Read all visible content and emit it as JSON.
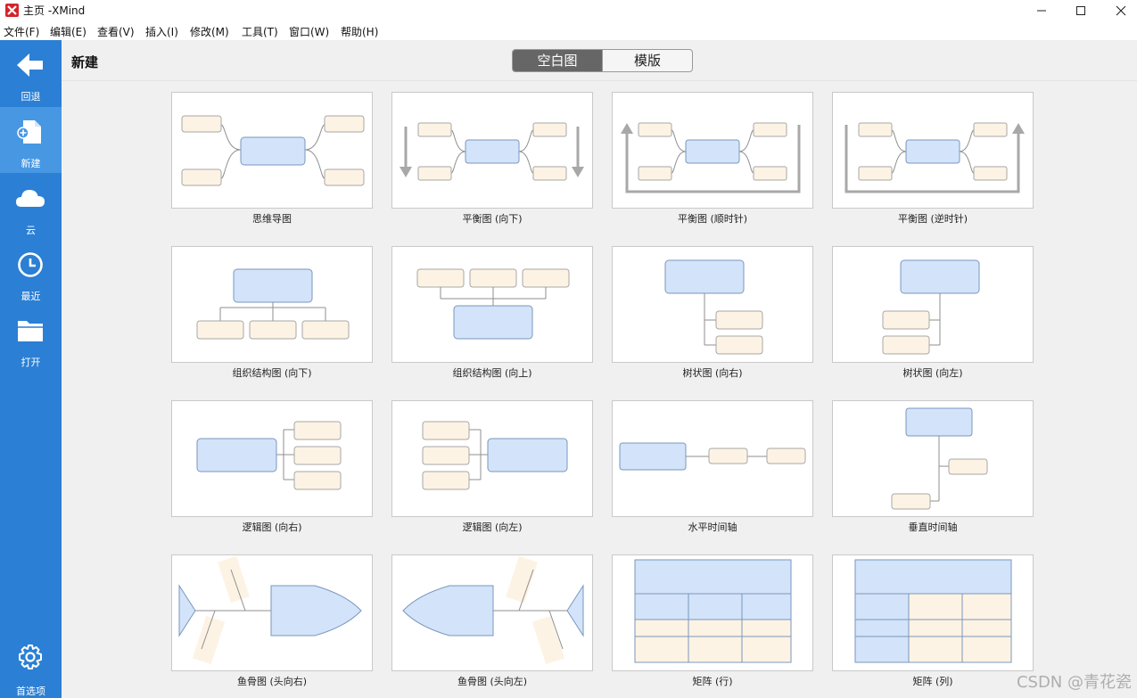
{
  "window": {
    "title": "主页 -XMind"
  },
  "menu": [
    "文件(F)",
    "编辑(E)",
    "查看(V)",
    "插入(I)",
    "修改(M)",
    "工具(T)",
    "窗口(W)",
    "帮助(H)"
  ],
  "sidebar": {
    "items": [
      {
        "label": "回退",
        "icon": "back-arrow-icon"
      },
      {
        "label": "新建",
        "icon": "new-file-icon",
        "active": true
      },
      {
        "label": "云",
        "icon": "cloud-icon"
      },
      {
        "label": "最近",
        "icon": "clock-icon"
      },
      {
        "label": "打开",
        "icon": "folder-icon"
      }
    ],
    "preferences": {
      "label": "首选项",
      "icon": "gear-icon"
    }
  },
  "header": {
    "title": "新建",
    "tabs": [
      {
        "label": "空白图",
        "active": true
      },
      {
        "label": "模版",
        "active": false
      }
    ]
  },
  "templates": [
    {
      "label": "思维导图",
      "kind": "mindmap"
    },
    {
      "label": "平衡图 (向下)",
      "kind": "balance-down"
    },
    {
      "label": "平衡图 (顺时针)",
      "kind": "balance-cw"
    },
    {
      "label": "平衡图 (逆时针)",
      "kind": "balance-ccw"
    },
    {
      "label": "组织结构图 (向下)",
      "kind": "org-down"
    },
    {
      "label": "组织结构图 (向上)",
      "kind": "org-up"
    },
    {
      "label": "树状图 (向右)",
      "kind": "tree-right"
    },
    {
      "label": "树状图 (向左)",
      "kind": "tree-left"
    },
    {
      "label": "逻辑图 (向右)",
      "kind": "logic-right"
    },
    {
      "label": "逻辑图 (向左)",
      "kind": "logic-left"
    },
    {
      "label": "水平时间轴",
      "kind": "timeline-h"
    },
    {
      "label": "垂直时间轴",
      "kind": "timeline-v"
    },
    {
      "label": "鱼骨图 (头向右)",
      "kind": "fish-right"
    },
    {
      "label": "鱼骨图 (头向左)",
      "kind": "fish-left"
    },
    {
      "label": "矩阵 (行)",
      "kind": "matrix-row"
    },
    {
      "label": "矩阵 (列)",
      "kind": "matrix-col"
    }
  ],
  "watermark": "CSDN @青花瓷",
  "colors": {
    "sidebar": "#2b7fd4",
    "sidebar_active": "#4797e2",
    "topic_blue": "#d3e3f9",
    "topic_cream": "#fdf3e4"
  }
}
